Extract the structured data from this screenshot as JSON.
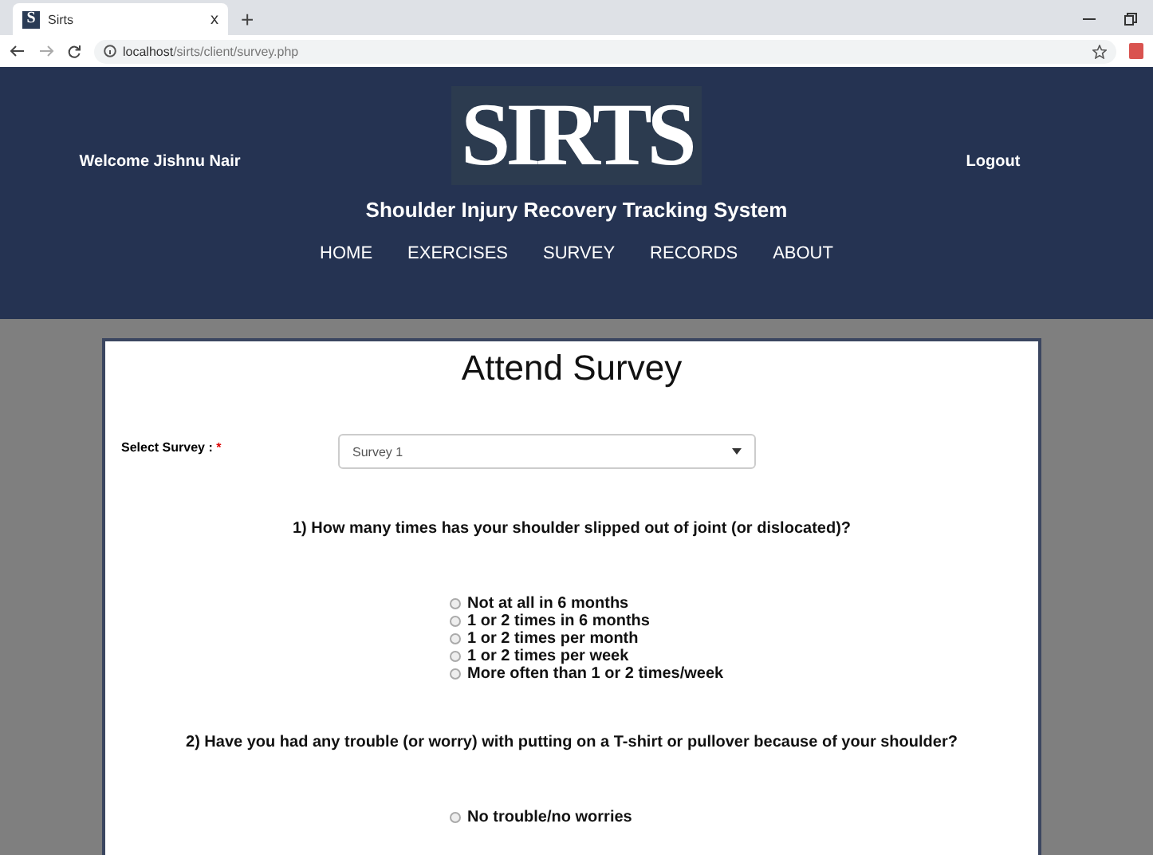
{
  "browser": {
    "tab": {
      "title": "Sirts",
      "icon_letter": "S",
      "close": "x"
    },
    "new_tab": "+",
    "url": {
      "host": "localhost",
      "path": "/sirts/client/survey.php"
    }
  },
  "header": {
    "welcome": "Welcome Jishnu Nair",
    "logo": "SIRTS",
    "logout": "Logout",
    "subtitle": "Shoulder Injury Recovery Tracking System",
    "nav": [
      {
        "label": "HOME"
      },
      {
        "label": "EXERCISES"
      },
      {
        "label": "SURVEY"
      },
      {
        "label": "RECORDS"
      },
      {
        "label": "ABOUT"
      }
    ]
  },
  "page": {
    "title": "Attend Survey",
    "select_label": "Select Survey :",
    "required_mark": "*",
    "select_value": "Survey 1",
    "questions": [
      {
        "text": "1) How many times has your shoulder slipped out of joint (or dislocated)?",
        "options": [
          {
            "label": "Not at all in 6 months",
            "selected": false
          },
          {
            "label": "1 or 2 times in 6 months",
            "selected": false
          },
          {
            "label": "1 or 2 times per month",
            "selected": false
          },
          {
            "label": "1 or 2 times per week",
            "selected": false
          },
          {
            "label": "More often than 1 or 2 times/week",
            "selected": false
          }
        ]
      },
      {
        "text": "2) Have you had any trouble (or worry) with putting on a T-shirt or pullover because of your shoulder?",
        "options": [
          {
            "label": "No trouble/no worries",
            "selected": false
          }
        ]
      }
    ]
  }
}
